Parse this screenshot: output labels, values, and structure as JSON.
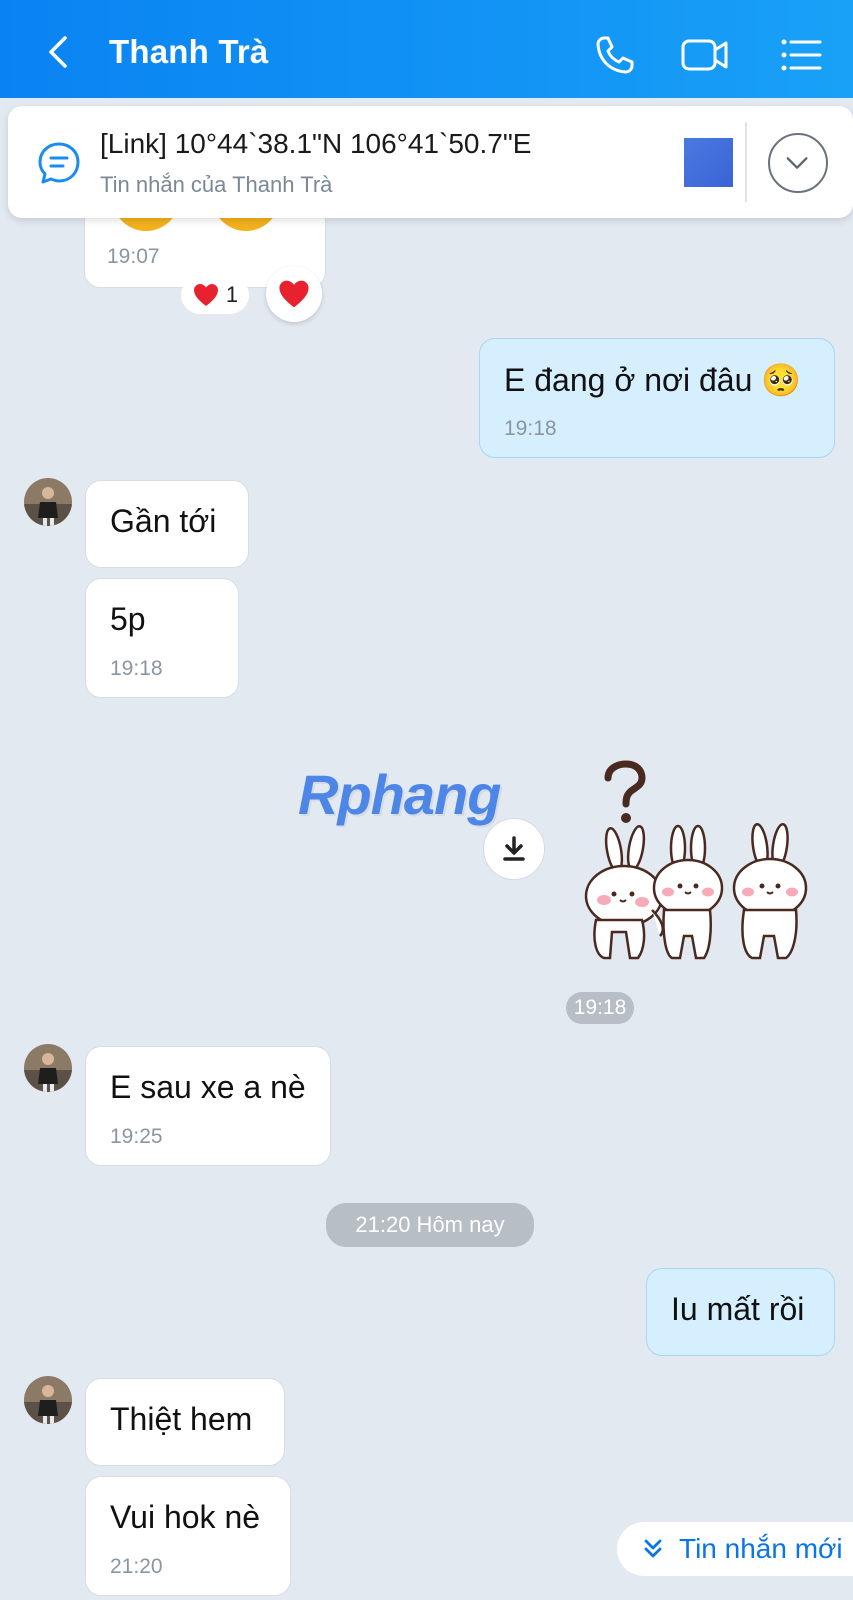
{
  "header": {
    "title": "Thanh Trà",
    "back_icon": "chevron-left-icon",
    "call_icon": "phone-icon",
    "video_icon": "video-icon",
    "menu_icon": "list-menu-icon"
  },
  "pinned": {
    "title": "[Link] 10°44`38.1\"N 106°41`50.7\"E",
    "subtitle": "Tin nhắn của Thanh Trà",
    "icon": "chat-bubble-icon",
    "expand_icon": "chevron-down-icon"
  },
  "previous": {
    "time": "19:07",
    "reaction_emoji": "❤️",
    "reaction_count": "1"
  },
  "messages": [
    {
      "from": "me",
      "text": "E đang ở nơi đâu 🥺",
      "time": "19:18"
    },
    {
      "from": "Thanh Trà",
      "text": "Gần tới"
    },
    {
      "from": "Thanh Trà",
      "text": "5p",
      "time": "19:18"
    },
    {
      "from": "me",
      "type": "sticker",
      "sticker": "three-bunnies-question-sticker",
      "time": "19:18"
    },
    {
      "from": "Thanh Trà",
      "text": "E sau xe a nè",
      "time": "19:25"
    },
    {
      "type": "date-separator",
      "text": "21:20 Hôm nay"
    },
    {
      "from": "me",
      "text": "Iu mất rồi"
    },
    {
      "from": "Thanh Trà",
      "text": "Thiệt hem"
    },
    {
      "from": "Thanh Trà",
      "text": "Vui hok nè",
      "time": "21:20"
    }
  ],
  "watermark": "Rphang",
  "new_message_button": {
    "label": "Tin nhắn mới",
    "icon": "double-chevron-down-icon"
  },
  "colors": {
    "header": "#0a83f2",
    "background": "#e2e9f1",
    "my_bubble": "#d6efff",
    "accent": "#0a75e6"
  }
}
